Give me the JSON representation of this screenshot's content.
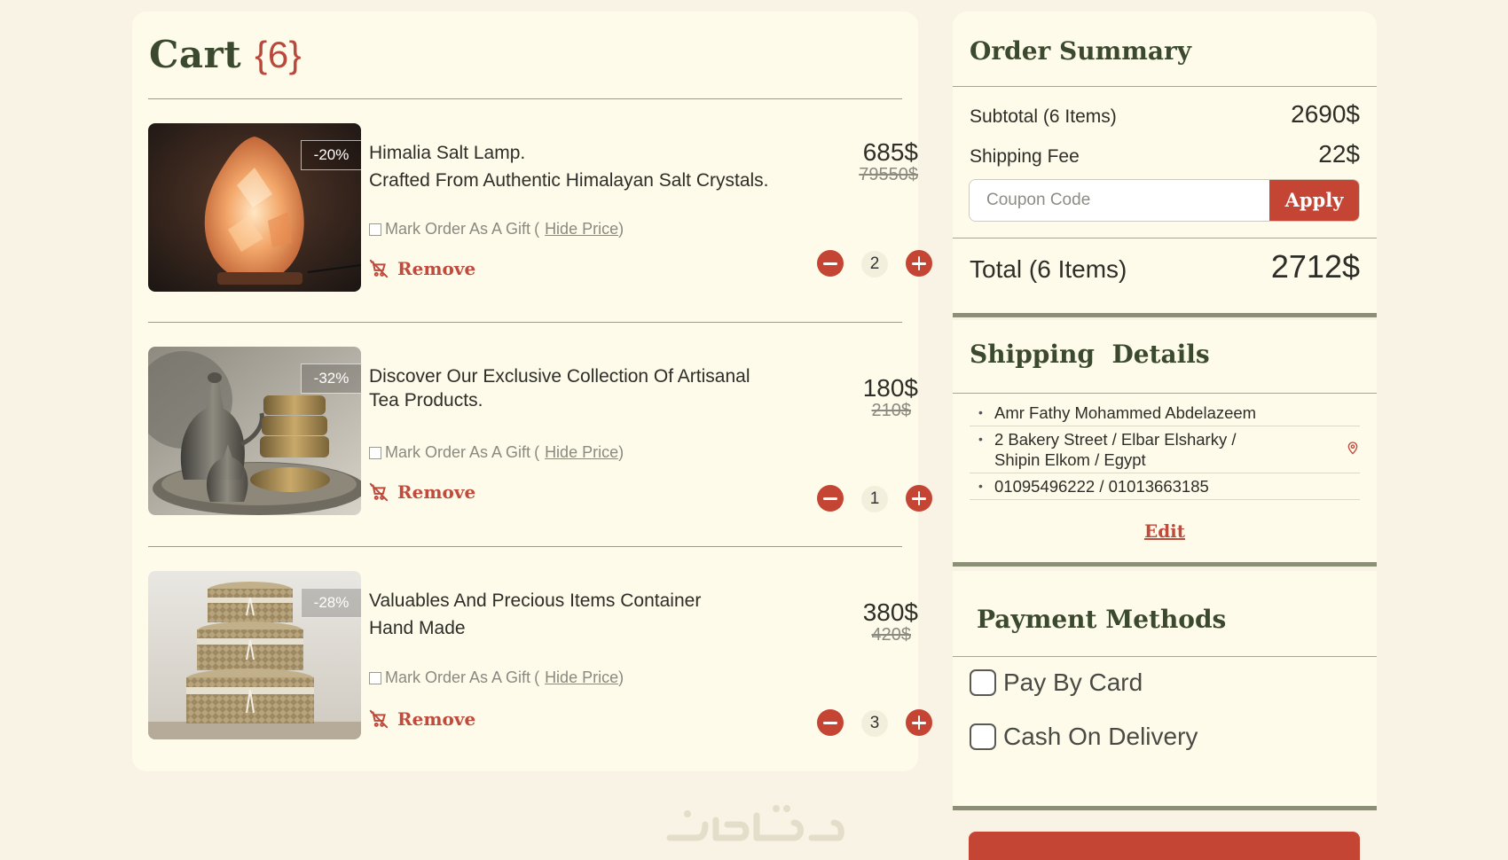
{
  "cart": {
    "title": "Cart",
    "count_text": "{6}",
    "items": [
      {
        "discount": "-20%",
        "line1": "Himalia Salt Lamp.",
        "line2": "Crafted From Authentic Himalayan Salt Crystals.",
        "price": "685$",
        "old_price": "79550$",
        "quantity": "2",
        "image": "salt-lamp"
      },
      {
        "discount": "-32%",
        "line1": "Discover Our Exclusive Collection Of Artisanal",
        "line2": "Tea Products.",
        "price": "180$",
        "old_price": "210$",
        "quantity": "1",
        "image": "tea-set"
      },
      {
        "discount": "-28%",
        "line1": "Valuables And Precious Items Container",
        "line2": "Hand Made",
        "price": "380$",
        "old_price": "420$",
        "quantity": "3",
        "image": "baskets"
      }
    ],
    "gift_label": "Mark Order As A Gift",
    "hide_price_label": "Hide Price",
    "remove_label": "Remove"
  },
  "summary": {
    "title": "Order Summary",
    "subtotal_label": "Subtotal (6 Items)",
    "subtotal_value": "2690$",
    "shipping_label": "Shipping Fee",
    "shipping_value": "22$",
    "coupon_placeholder": "Coupon Code",
    "apply_label": "Apply",
    "total_label": "Total (6 Items)",
    "total_value": "2712$"
  },
  "shipping": {
    "title": "Shipping  Details",
    "name": "Amr Fathy Mohammed Abdelazeem",
    "address_line1": "2 Bakery Street / Elbar Elsharky /",
    "address_line2": "Shipin Elkom / Egypt",
    "phones": "01095496222 / 01013663185",
    "edit_label": "Edit"
  },
  "payment": {
    "title": "Payment Methods",
    "options": [
      "Pay By Card",
      "Cash On Delivery"
    ]
  },
  "colors": {
    "accent": "#c54535",
    "title_green": "#3b4a2f",
    "panel": "#fefbea",
    "background": "#f8f3e4"
  }
}
